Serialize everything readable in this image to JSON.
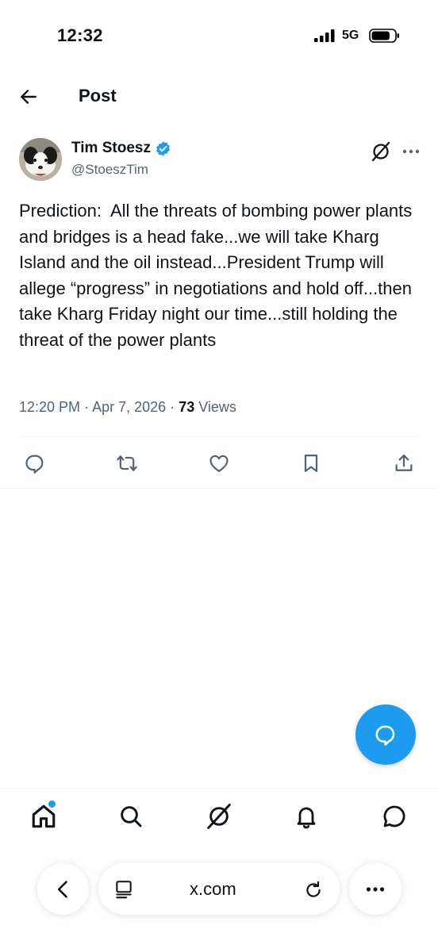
{
  "status_bar": {
    "time": "12:32",
    "network": "5G",
    "battery_level": 0.8
  },
  "header": {
    "title": "Post",
    "back_icon": "arrow-left-icon"
  },
  "post": {
    "author": {
      "name": "Tim Stoesz",
      "handle": "@StoeszTim",
      "verified": true
    },
    "text": "Prediction:  All the threats of bombing power plants and bridges is a head fake...we will take Kharg Island and the oil instead...President Trump will allege “progress” in negotiations and hold off...then take Kharg Friday night our time...still holding the threat of the power plants",
    "time": "12:20 PM",
    "separator": "·",
    "date": "Apr 7, 2026",
    "views_count": "73",
    "views_label": "Views",
    "actions": [
      "reply-icon",
      "repost-icon",
      "like-icon",
      "bookmark-icon",
      "share-icon"
    ]
  },
  "bottom_nav": {
    "items": [
      "home-icon",
      "search-icon",
      "grok-icon",
      "notifications-icon",
      "messages-icon"
    ],
    "home_has_dot": true
  },
  "browser": {
    "url": "x.com"
  },
  "colors": {
    "accent": "#1d9bf0",
    "text": "#0f1419",
    "secondary": "#536471",
    "border": "#eff3f4"
  }
}
